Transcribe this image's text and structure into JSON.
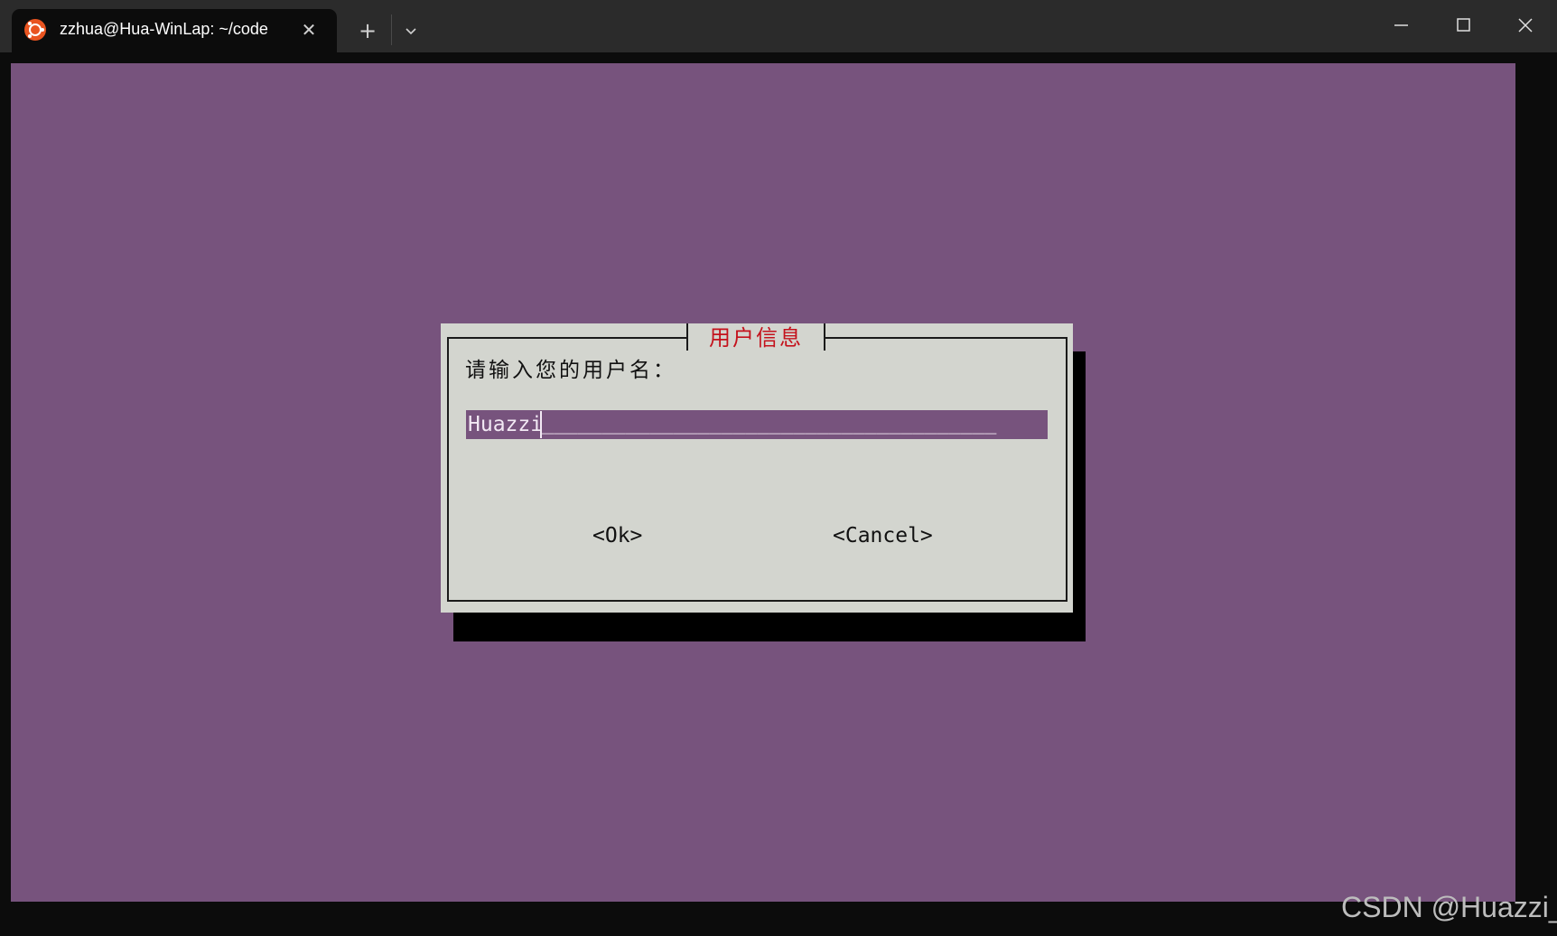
{
  "window": {
    "tab_title": "zzhua@Hua-WinLap: ~/code",
    "tab_icon": "ubuntu-icon",
    "new_tab_symbol": "+",
    "close_tab_symbol": "✕"
  },
  "colors": {
    "terminal_bg": "#77537d",
    "dialog_bg": "#d3d5cf",
    "title_text": "#c4121c",
    "ubuntu_orange": "#e95420"
  },
  "dialog": {
    "title": "用户信息",
    "prompt": "请输入您的用户名：",
    "input_value": "Huazzi",
    "input_fill": "______________________________________",
    "ok_label": "<Ok>",
    "cancel_label": "<Cancel>"
  },
  "watermark": "CSDN @Huazzi_"
}
